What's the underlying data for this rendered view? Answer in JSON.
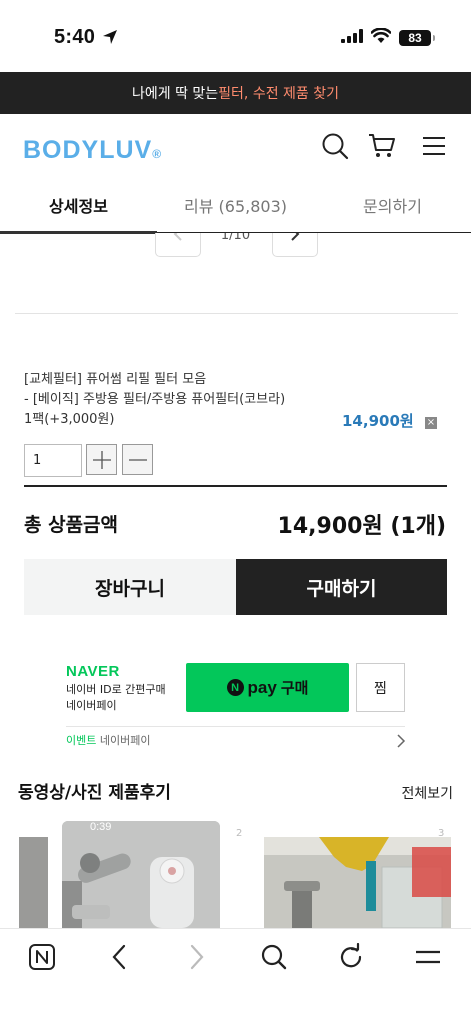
{
  "status": {
    "time": "5:40",
    "battery": "83"
  },
  "promo": {
    "prefix": "나에게 딱 맞는 ",
    "highlight": "필터, 수전 제품 찾기"
  },
  "header": {
    "logo": "BODYLUV",
    "logo_mark": "®"
  },
  "tabs": [
    {
      "label": "상세정보",
      "active": true
    },
    {
      "label": "리뷰 (65,803)",
      "active": false
    },
    {
      "label": "문의하기",
      "active": false
    }
  ],
  "pager": {
    "count": "1/10"
  },
  "option": {
    "title": "[교체필터] 퓨어썸 리필 필터 모음",
    "variant": "- [베이직] 주방용 필터/주방용 퓨어필터(코브라)",
    "pack": "1팩(+3,000원)",
    "price": "14,900원",
    "delete": "×",
    "quantity": "1"
  },
  "total": {
    "label": "총 상품금액",
    "value": "14,900원 (1개)"
  },
  "actions": {
    "cart": "장바구니",
    "buy": "구매하기"
  },
  "npay": {
    "brand": "NAVER",
    "desc_line1": "네이버 ID로 간편구매",
    "desc_line2": "네이버페이",
    "n_mark": "N",
    "pay": "pay",
    "buy": "구매",
    "wish": "찜",
    "event_label": "이벤트",
    "event_text": "네이버페이"
  },
  "reviews": {
    "title": "동영상/사진 제품후기",
    "view_all": "전체보기",
    "items": [
      {
        "duration": "0:39",
        "num": "2"
      },
      {
        "num": "3"
      }
    ]
  },
  "colors": {
    "brand": "#5aaee8",
    "naver": "#03c75a",
    "price": "#2a7ab8",
    "promo_highlight": "#ff8c6e"
  },
  "icons": [
    "location-arrow-icon",
    "signal-icon",
    "wifi-icon",
    "search-icon",
    "cart-icon",
    "menu-icon",
    "chevron-left-icon",
    "chevron-right-icon",
    "plus-icon",
    "minus-icon",
    "naver-home-icon",
    "back-icon",
    "forward-icon",
    "refresh-icon"
  ]
}
